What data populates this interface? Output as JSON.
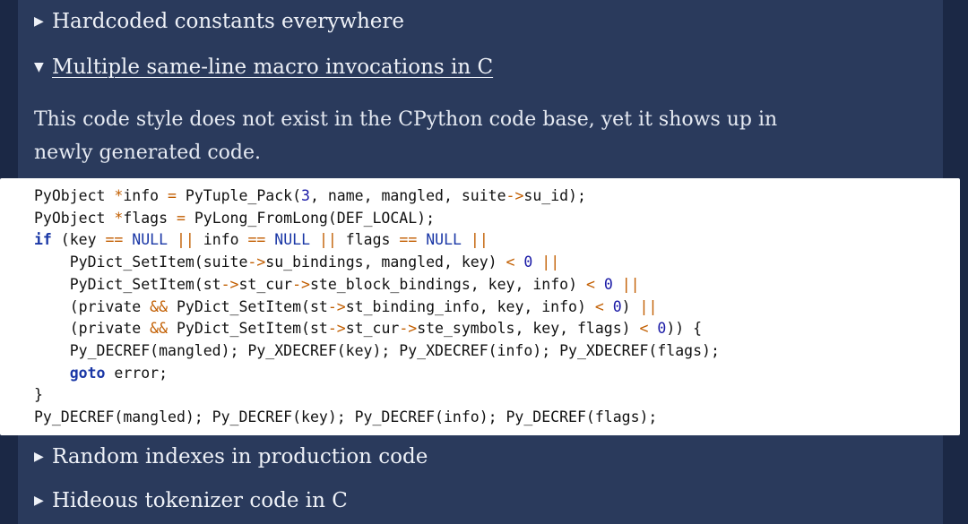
{
  "details": [
    {
      "marker": "▶",
      "label": "Hardcoded constants everywhere",
      "open": false
    },
    {
      "marker": "▼",
      "label": "Multiple same-line macro invocations in C",
      "open": true
    },
    {
      "marker": "▶",
      "label": "Random indexes in production code",
      "open": false
    },
    {
      "marker": "▶",
      "label": "Hideous tokenizer code in C",
      "open": false
    }
  ],
  "open_section": {
    "description": "This code style does not exist in the CPython code base, yet it shows up in newly generated code."
  },
  "code": {
    "language": "c",
    "lines": [
      [
        [
          "t",
          "PyObject "
        ],
        [
          "op",
          "*"
        ],
        [
          "t",
          "info "
        ],
        [
          "op",
          "="
        ],
        [
          "t",
          " PyTuple_Pack("
        ],
        [
          "num",
          "3"
        ],
        [
          "t",
          ", name, mangled, suite"
        ],
        [
          "op",
          "->"
        ],
        [
          "t",
          "su_id);"
        ]
      ],
      [
        [
          "t",
          "PyObject "
        ],
        [
          "op",
          "*"
        ],
        [
          "t",
          "flags "
        ],
        [
          "op",
          "="
        ],
        [
          "t",
          " PyLong_FromLong(DEF_LOCAL);"
        ]
      ],
      [
        [
          "kw",
          "if"
        ],
        [
          "t",
          " (key "
        ],
        [
          "op",
          "=="
        ],
        [
          "t",
          " "
        ],
        [
          "null",
          "NULL"
        ],
        [
          "t",
          " "
        ],
        [
          "op",
          "||"
        ],
        [
          "t",
          " info "
        ],
        [
          "op",
          "=="
        ],
        [
          "t",
          " "
        ],
        [
          "null",
          "NULL"
        ],
        [
          "t",
          " "
        ],
        [
          "op",
          "||"
        ],
        [
          "t",
          " flags "
        ],
        [
          "op",
          "=="
        ],
        [
          "t",
          " "
        ],
        [
          "null",
          "NULL"
        ],
        [
          "t",
          " "
        ],
        [
          "op",
          "||"
        ]
      ],
      [
        [
          "t",
          "    PyDict_SetItem(suite"
        ],
        [
          "op",
          "->"
        ],
        [
          "t",
          "su_bindings, mangled, key) "
        ],
        [
          "op",
          "<"
        ],
        [
          "t",
          " "
        ],
        [
          "num",
          "0"
        ],
        [
          "t",
          " "
        ],
        [
          "op",
          "||"
        ]
      ],
      [
        [
          "t",
          "    PyDict_SetItem(st"
        ],
        [
          "op",
          "->"
        ],
        [
          "t",
          "st_cur"
        ],
        [
          "op",
          "->"
        ],
        [
          "t",
          "ste_block_bindings, key, info) "
        ],
        [
          "op",
          "<"
        ],
        [
          "t",
          " "
        ],
        [
          "num",
          "0"
        ],
        [
          "t",
          " "
        ],
        [
          "op",
          "||"
        ]
      ],
      [
        [
          "t",
          "    (private "
        ],
        [
          "op",
          "&&"
        ],
        [
          "t",
          " PyDict_SetItem(st"
        ],
        [
          "op",
          "->"
        ],
        [
          "t",
          "st_binding_info, key, info) "
        ],
        [
          "op",
          "<"
        ],
        [
          "t",
          " "
        ],
        [
          "num",
          "0"
        ],
        [
          "t",
          ") "
        ],
        [
          "op",
          "||"
        ]
      ],
      [
        [
          "t",
          "    (private "
        ],
        [
          "op",
          "&&"
        ],
        [
          "t",
          " PyDict_SetItem(st"
        ],
        [
          "op",
          "->"
        ],
        [
          "t",
          "st_cur"
        ],
        [
          "op",
          "->"
        ],
        [
          "t",
          "ste_symbols, key, flags) "
        ],
        [
          "op",
          "<"
        ],
        [
          "t",
          " "
        ],
        [
          "num",
          "0"
        ],
        [
          "t",
          ")) {"
        ]
      ],
      [
        [
          "t",
          "    Py_DECREF(mangled); Py_XDECREF(key); Py_XDECREF(info); Py_XDECREF(flags);"
        ]
      ],
      [
        [
          "t",
          "    "
        ],
        [
          "kw",
          "goto"
        ],
        [
          "t",
          " error;"
        ]
      ],
      [
        [
          "t",
          "}"
        ]
      ],
      [
        [
          "t",
          "Py_DECREF(mangled); Py_DECREF(key); Py_DECREF(info); Py_DECREF(flags);"
        ]
      ]
    ]
  }
}
